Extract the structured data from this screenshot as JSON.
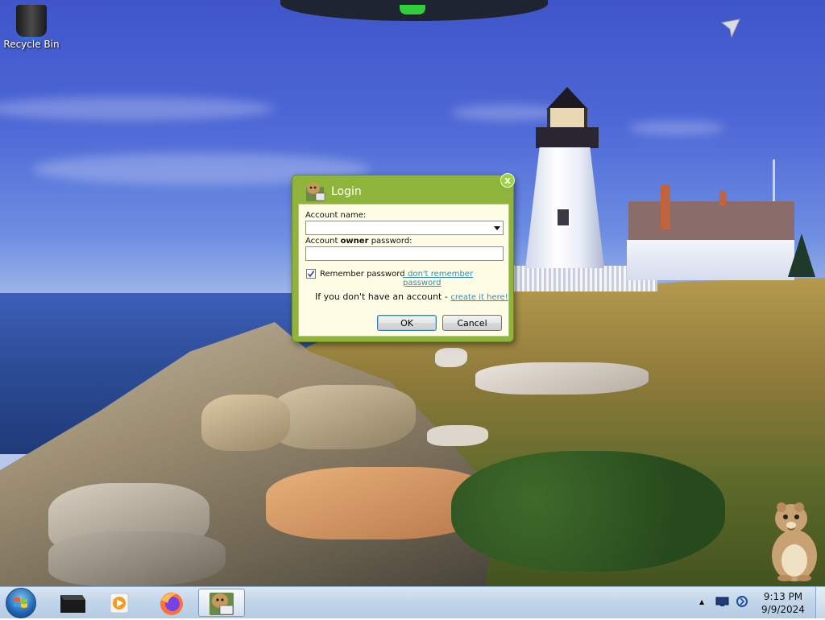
{
  "desktop": {
    "icons": [
      {
        "label": "Recycle Bin",
        "icon": "recycle-bin-icon"
      }
    ]
  },
  "dialog": {
    "title": "Login",
    "close_glyph": "x",
    "account_name_label": "Account name:",
    "account_name_value": "",
    "password_label_prefix": "Account ",
    "password_label_bold": "owner",
    "password_label_suffix": " password:",
    "password_value": "",
    "remember_label": "Remember password",
    "remember_checked": true,
    "forgot_link": "I don't remember password",
    "no_account_text": "If you don't have an account - ",
    "create_link": "create it here!",
    "ok_label": "OK",
    "cancel_label": "Cancel"
  },
  "taskbar": {
    "items": [
      {
        "name": "start-button",
        "icon": "windows-orb-icon"
      },
      {
        "name": "taskbar-terminal",
        "icon": "black-box-icon"
      },
      {
        "name": "taskbar-media-player",
        "icon": "media-player-icon"
      },
      {
        "name": "taskbar-firefox",
        "icon": "firefox-icon"
      },
      {
        "name": "taskbar-hamster-app",
        "icon": "hamster-box-icon",
        "active": true
      }
    ],
    "tray": {
      "show_hidden_glyph": "▲",
      "clock_time": "9:13 PM",
      "clock_date": "9/9/2024"
    }
  },
  "colors": {
    "dialog_frame": "#8fb43b",
    "dialog_body": "#fffde6",
    "link": "#2c8fb0"
  }
}
